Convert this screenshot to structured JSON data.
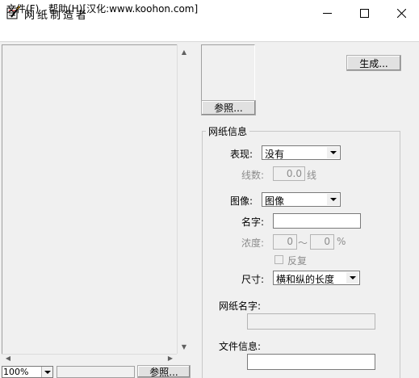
{
  "window": {
    "title": "网纸制造者",
    "minimize_glyph": "—",
    "maximize_glyph": "☐",
    "close_glyph": "✕"
  },
  "menu": {
    "file": "文件(F)",
    "help": "帮助(H)[汉化:www.koohon.com]"
  },
  "left_panel": {
    "zoom": "100%",
    "browse_label": "参照..."
  },
  "preview": {
    "browse_label": "参照..."
  },
  "generate_label": "生成...",
  "group": {
    "title": "网纸信息",
    "expression_label": "表现:",
    "expression_value": "没有",
    "lines_label": "线数:",
    "lines_value": "0.0",
    "lines_unit": "线",
    "image_label": "图像:",
    "image_value": "图像",
    "name_label": "名字:",
    "name_value": "",
    "density_label": "浓度:",
    "density_from": "0",
    "density_sep": "～",
    "density_to": "0",
    "density_unit": "%",
    "reverse_label": "反复",
    "size_label": "尺寸:",
    "size_value": "横和纵的长度",
    "net_name_label": "网纸名字:",
    "net_name_value": "",
    "file_info_label": "文件信息:",
    "file_info_value": ""
  },
  "colors": {
    "background": "#f0f0f0",
    "titlebar": "#ffffff",
    "disabled_text": "#8c8c8c"
  }
}
